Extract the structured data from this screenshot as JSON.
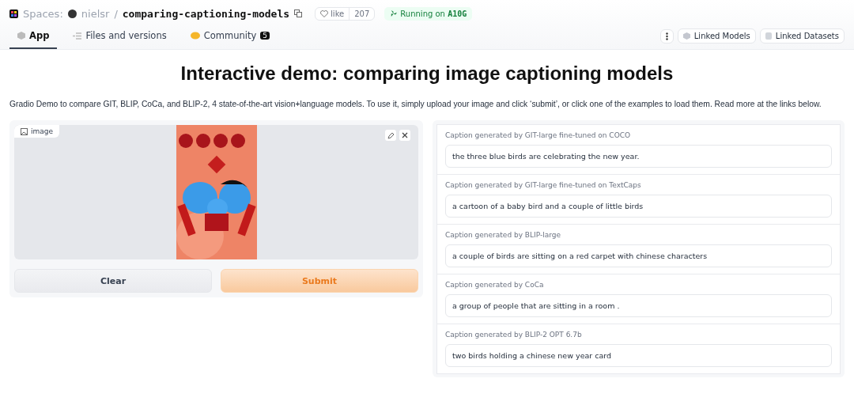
{
  "header": {
    "spaces_label": "Spaces:",
    "owner": "nielsr",
    "separator": "/",
    "repo": "comparing-captioning-models",
    "like_label": "like",
    "like_count": "207",
    "status": "Running on",
    "hardware": "A10G"
  },
  "tabs": [
    {
      "label": "App",
      "selected": true,
      "kind": "app"
    },
    {
      "label": "Files and versions",
      "selected": false,
      "kind": "files"
    },
    {
      "label": "Community",
      "selected": false,
      "kind": "community",
      "badge": "5"
    }
  ],
  "header_buttons": [
    {
      "label": "Linked Models",
      "kind": "model"
    },
    {
      "label": "Linked Datasets",
      "kind": "dataset"
    }
  ],
  "title": "Interactive demo: comparing image captioning models",
  "description": "Gradio Demo to compare GIT, BLIP, CoCa, and BLIP-2, 4 state-of-the-art vision+language models. To use it, simply upload your image and click ‘submit’, or click one of the examples to load them. Read more at the links below.",
  "image_input": {
    "label": "image",
    "kind": "picture"
  },
  "buttons": [
    {
      "label": "Clear",
      "kind": "secondary"
    },
    {
      "label": "Submit",
      "kind": "primary"
    }
  ],
  "captions": [
    {
      "label": "Caption generated by GIT-large fine-tuned on COCO",
      "value": "the three blue birds are celebrating the new year."
    },
    {
      "label": "Caption generated by GIT-large fine-tuned on TextCaps",
      "value": "a cartoon of a baby bird and a couple of little birds"
    },
    {
      "label": "Caption generated by BLIP-large",
      "value": "a couple of birds are sitting on a red carpet with chinese characters"
    },
    {
      "label": "Caption generated by CoCa",
      "value": "a group of people that are sitting in a room ."
    },
    {
      "label": "Caption generated by BLIP-2 OPT 6.7b",
      "value": "two birds holding a chinese new year card"
    }
  ]
}
